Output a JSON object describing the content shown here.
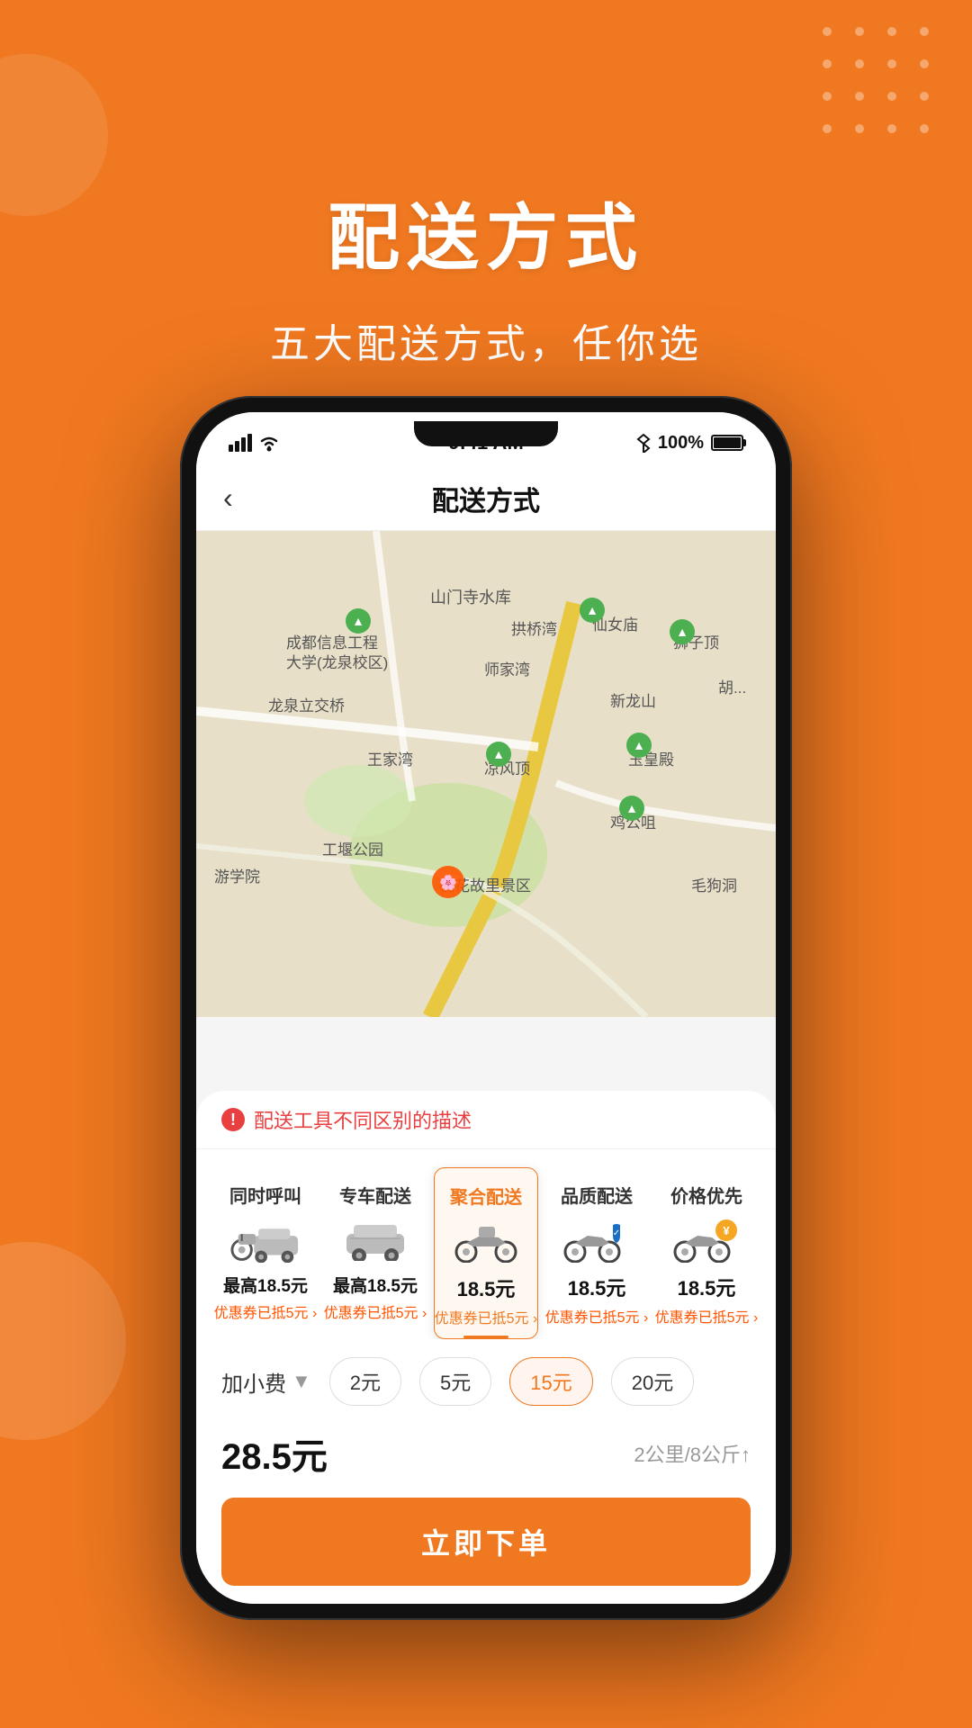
{
  "background_color": "#F07820",
  "decorative": {
    "dot_grid": true,
    "circle_tl": true,
    "circle_bl": true
  },
  "header": {
    "title": "配送方式",
    "subtitle": "五大配送方式，任你选"
  },
  "phone": {
    "status_bar": {
      "time": "9:41 AM",
      "battery_percent": "100%",
      "signal": "full",
      "wifi": true,
      "bluetooth": true
    },
    "nav": {
      "back_icon": "‹",
      "title": "配送方式"
    },
    "map": {
      "places": [
        "山门寺水库",
        "成都信息工程大学(龙泉校区)",
        "龙泉立交桥",
        "仙女庙",
        "狮子顶",
        "新龙山",
        "玉皇殿",
        "鸡公咀",
        "凉风顶",
        "桃花故里景区",
        "王家湾",
        "师家湾",
        "拱桥湾"
      ]
    },
    "warning": {
      "icon": "!",
      "text": "配送工具不同区别的描述"
    },
    "delivery_options": [
      {
        "name": "同时呼叫",
        "icon_type": "moto_car",
        "price": "最高18.5元",
        "coupon": "优惠券已抵5元 ›",
        "active": false
      },
      {
        "name": "专车配送",
        "icon_type": "car",
        "price": "最高18.5元",
        "coupon": "优惠券已抵5元 ›",
        "active": false
      },
      {
        "name": "聚合配送",
        "icon_type": "moto",
        "price": "18.5元",
        "coupon": "优惠券已抵5元 ›",
        "active": true
      },
      {
        "name": "品质配送",
        "icon_type": "moto_shield",
        "price": "18.5元",
        "coupon": "优惠券已抵5元 ›",
        "active": false
      },
      {
        "name": "价格优先",
        "icon_type": "moto_bag",
        "price": "18.5元",
        "coupon": "优惠券已抵5元 ›",
        "active": false
      }
    ],
    "add_fee": {
      "label": "加小费",
      "options": [
        "2元",
        "5元",
        "15元",
        "20元"
      ],
      "active_option": "15元"
    },
    "total": {
      "price": "28.5元",
      "info": "2公里/8公斤↑"
    },
    "order_button": "立即下单"
  }
}
